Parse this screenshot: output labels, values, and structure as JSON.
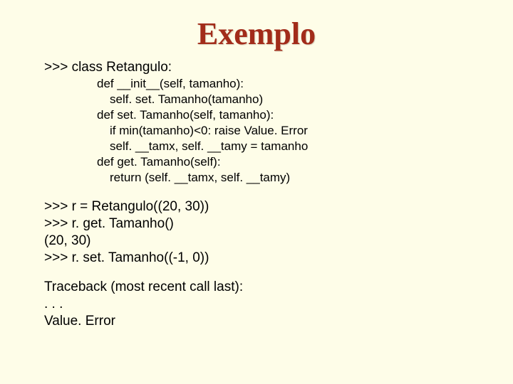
{
  "title": "Exemplo",
  "code": {
    "l1": ">>> class Retangulo:",
    "l2": "def __init__(self, tamanho):",
    "l3": "self. set. Tamanho(tamanho)",
    "l4": "def set. Tamanho(self, tamanho):",
    "l5": "if min(tamanho)<0: raise Value. Error",
    "l6": "self. __tamx, self. __tamy = tamanho",
    "l7": "def get. Tamanho(self):",
    "l8": "return (self. __tamx, self. __tamy)"
  },
  "session": {
    "l1": ">>> r = Retangulo((20, 30))",
    "l2": ">>> r. get. Tamanho()",
    "l3": "(20, 30)",
    "l4": ">>> r. set. Tamanho((-1, 0))"
  },
  "traceback": {
    "l1": "Traceback (most recent call last):",
    "l2": ". . .",
    "l3": "Value. Error"
  }
}
